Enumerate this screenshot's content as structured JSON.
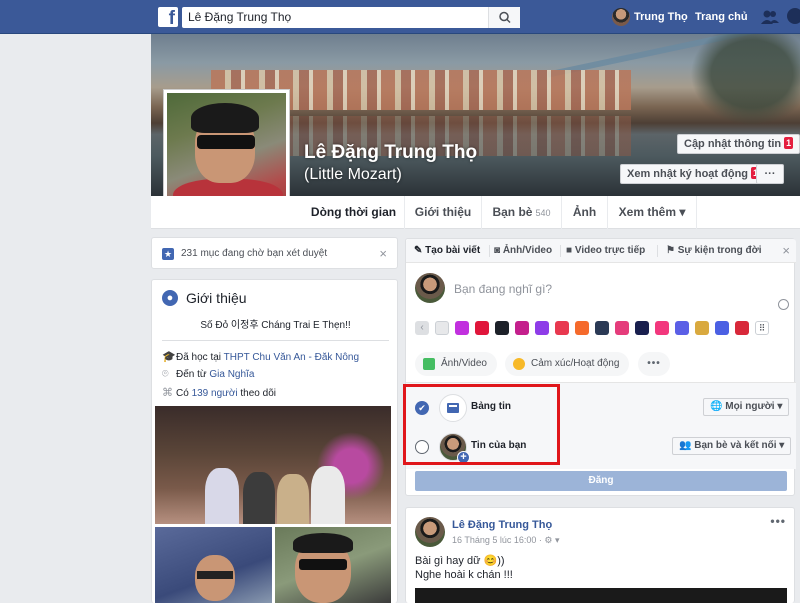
{
  "topbar": {
    "logo": "f",
    "search_value": "Lê Đặng Trung Thọ",
    "user_name": "Trung Thọ",
    "home_label": "Trang chủ"
  },
  "cover": {
    "name": "Lê Đặng Trung Thọ",
    "nickname": "(Little Mozart)",
    "update_info_label": "Cập nhật thông tin",
    "update_info_badge": "1",
    "activity_log_label": "Xem nhật ký hoạt động",
    "activity_log_badge": "10+",
    "more_label": "···"
  },
  "tabs": [
    {
      "label": "Dòng thời gian"
    },
    {
      "label": "Giới thiệu"
    },
    {
      "label": "Bạn bè",
      "count": "540"
    },
    {
      "label": "Ảnh"
    },
    {
      "label": "Xem thêm ▾"
    }
  ],
  "pending": {
    "text": "231 mục đang chờ bạn xét duyệt",
    "close": "×"
  },
  "intro": {
    "title": "Giới thiệu",
    "bio": "Số Đỏ 이정후 Cháng Trai E Thẹn!!",
    "studied_prefix": "Đã học tại ",
    "studied_link": "THPT Chu Văn An - Đăk Nông",
    "from_prefix": "Đến từ ",
    "from_link": "Gia Nghĩa",
    "followers_prefix": "Có ",
    "followers_link": "139 người",
    "followers_suffix": " theo dõi"
  },
  "composer": {
    "tabs": [
      "Tạo bài viết",
      "Ảnh/Video",
      "Video trực tiếp",
      "Sự kiện trong đời"
    ],
    "close": "×",
    "placeholder": "Bạn đang nghĩ gì?",
    "buttons": [
      "Ảnh/Video",
      "Cảm xúc/Hoạt động",
      "•••"
    ],
    "audience": [
      {
        "label": "Bảng tin",
        "checked": true,
        "dropdown": "Mọi người ▾"
      },
      {
        "label": "Tin của bạn",
        "checked": false,
        "dropdown": "Bạn bè và kết nối ▾"
      }
    ],
    "post_label": "Đăng",
    "swatch_colors": [
      "#dddfe2",
      "#e7e8ea",
      "#c130de",
      "#e0163b",
      "#1d2129",
      "#c41f8c",
      "#8e3ce8",
      "#e8384f",
      "#f56a2c",
      "#2b3a55",
      "#e53c7b",
      "#191f4e",
      "#f2377d",
      "#5b5fe6",
      "#d9a93f",
      "#4b60e3",
      "#d8283a",
      "#4b4f56"
    ]
  },
  "post": {
    "author": "Lê Đặng Trung Thọ",
    "meta": "16 Tháng 5 lúc 16:00 · ⚙ ▾",
    "line1": "Bài gì hay dữ 😊))",
    "line2": "Nghe hoài k chán !!!",
    "more": "•••"
  }
}
